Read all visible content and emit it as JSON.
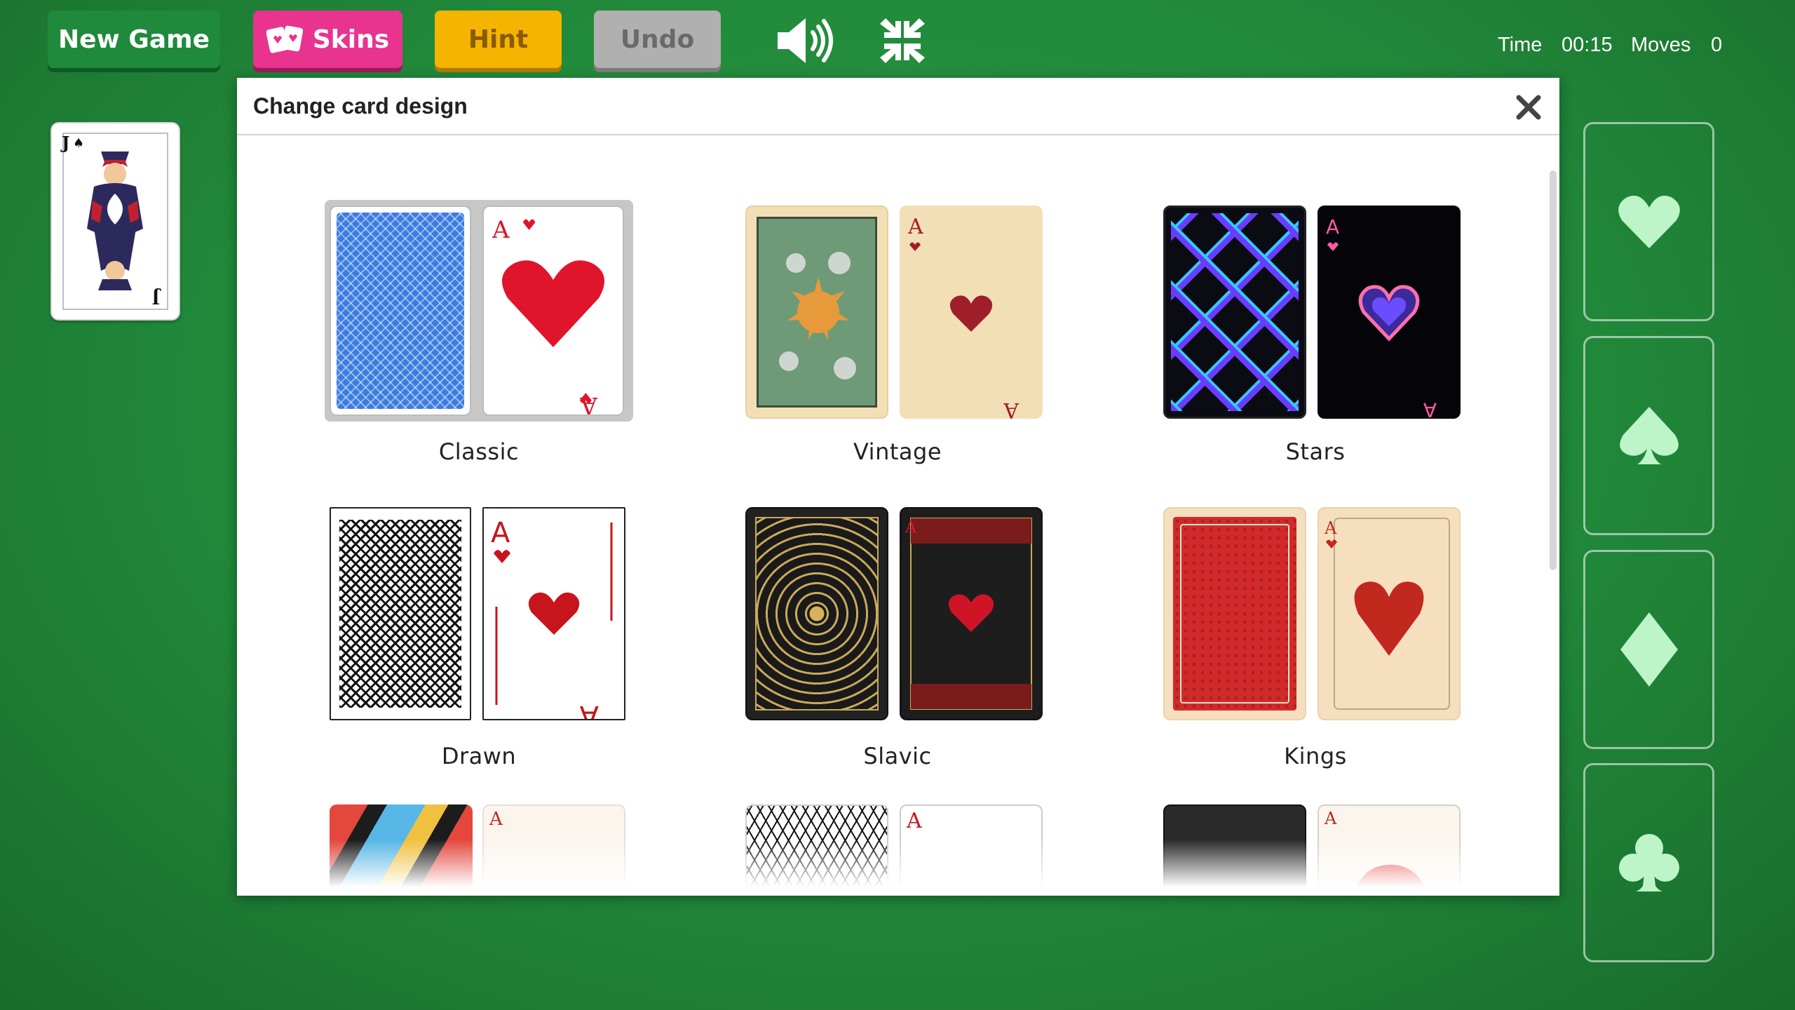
{
  "toolbar": {
    "new_game": "New Game",
    "skins": "Skins",
    "hint": "Hint",
    "undo": "Undo",
    "sound_icon": "speaker-icon",
    "fullscreen_icon": "collapse-icon"
  },
  "stats": {
    "time_label": "Time",
    "time_value": "00:15",
    "moves_label": "Moves",
    "moves_value": "0"
  },
  "deck": {
    "rank": "J",
    "suit": "♠"
  },
  "foundations": [
    "♥",
    "♠",
    "♦",
    "♣"
  ],
  "modal": {
    "title": "Change card design",
    "close_icon": "close-icon",
    "skins": [
      {
        "name": "Classic",
        "selected": true
      },
      {
        "name": "Vintage",
        "selected": false
      },
      {
        "name": "Stars",
        "selected": false
      },
      {
        "name": "Drawn",
        "selected": false
      },
      {
        "name": "Slavic",
        "selected": false
      },
      {
        "name": "Kings",
        "selected": false
      }
    ]
  },
  "colors": {
    "felt": "#21883a",
    "new_game": "#1f8a3b",
    "skins": "#e8338f",
    "hint": "#f5b400",
    "undo": "#b0b0b0",
    "heart_red": "#e0142a"
  }
}
